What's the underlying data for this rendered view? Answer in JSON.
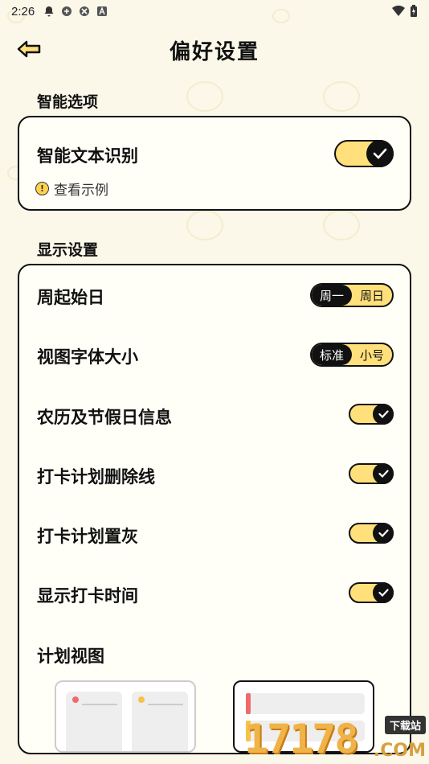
{
  "status_bar": {
    "time": "2:26"
  },
  "header": {
    "title": "偏好设置"
  },
  "smart_section": {
    "title": "智能选项",
    "text_recognition": {
      "label": "智能文本识别",
      "enabled": true
    },
    "example_link": "查看示例"
  },
  "display_section": {
    "title": "显示设置",
    "week_start": {
      "label": "周起始日",
      "options": [
        "周一",
        "周日"
      ],
      "selected": "周一"
    },
    "font_size": {
      "label": "视图字体大小",
      "options": [
        "标准",
        "小号"
      ],
      "selected": "标准"
    },
    "toggles": [
      {
        "label": "农历及节假日信息",
        "enabled": true
      },
      {
        "label": "打卡计划删除线",
        "enabled": true
      },
      {
        "label": "打卡计划置灰",
        "enabled": true
      },
      {
        "label": "显示打卡时间",
        "enabled": true
      }
    ],
    "plan_view": {
      "label": "计划视图"
    }
  },
  "watermark": {
    "digits": "17178",
    "badge": "下载站",
    "suffix": ".COM"
  },
  "colors": {
    "accent": "#ffe07a",
    "background": "#fbf8ea",
    "ink": "#111111"
  },
  "icons": [
    "back-arrow-icon",
    "check-icon",
    "warning-icon"
  ]
}
